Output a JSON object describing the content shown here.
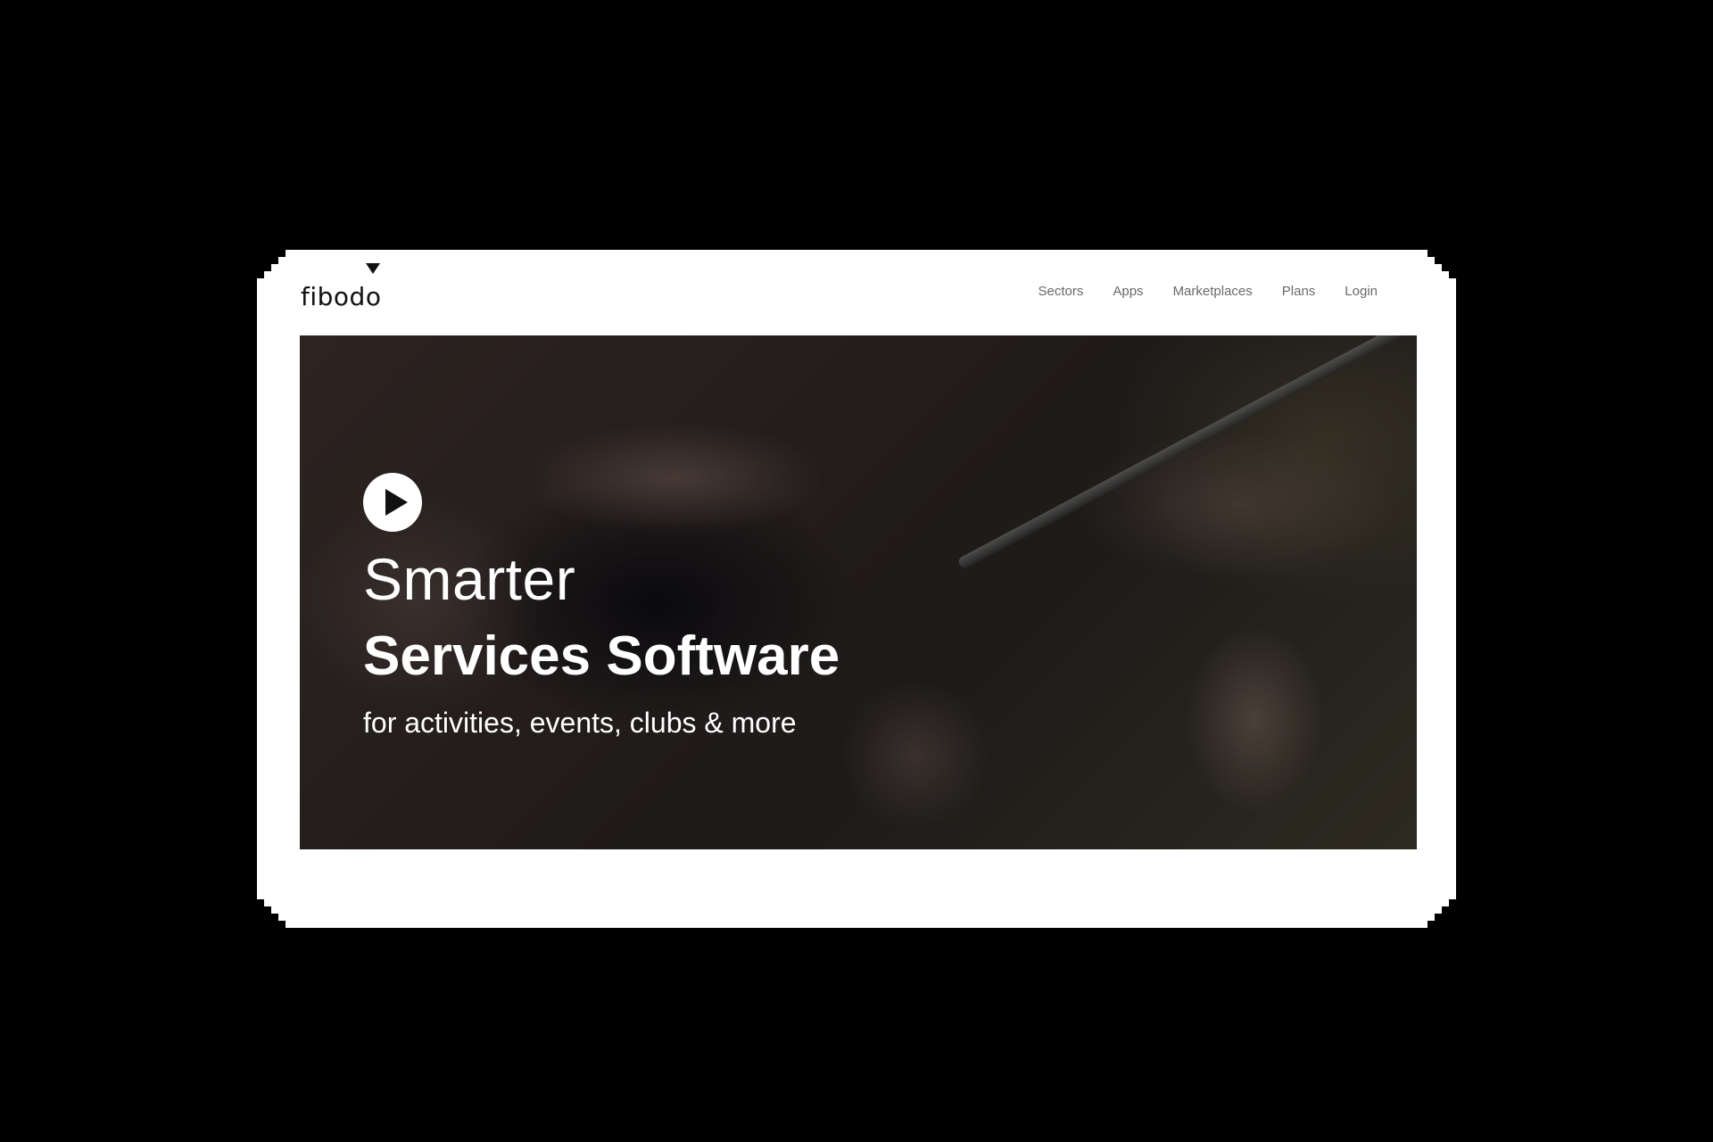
{
  "brand": {
    "logo_text": "fibodo",
    "logo_mark_icon": "triangle-down-icon"
  },
  "nav": {
    "items": [
      {
        "label": "Sectors"
      },
      {
        "label": "Apps"
      },
      {
        "label": "Marketplaces"
      },
      {
        "label": "Plans"
      },
      {
        "label": "Login"
      }
    ]
  },
  "hero": {
    "play_icon": "play-icon",
    "line1": "Smarter",
    "line2": "Services Software",
    "line3": "for activities, events, clubs & more"
  },
  "colors": {
    "page_background": "#000000",
    "card_background": "#ffffff",
    "nav_text": "#6a6a6a",
    "hero_text": "#ffffff"
  }
}
